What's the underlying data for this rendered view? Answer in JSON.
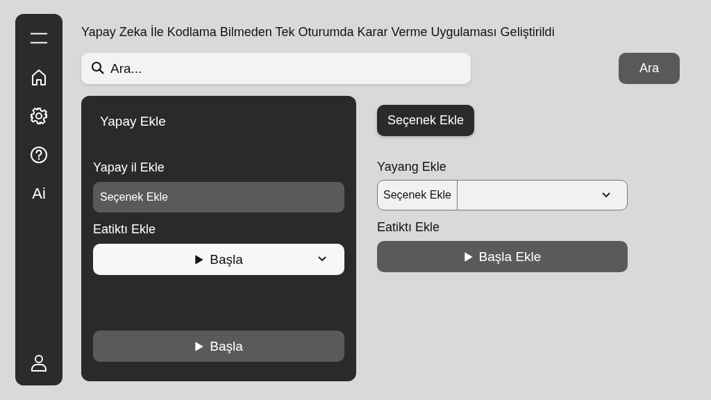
{
  "sidebar": {
    "items": [
      {
        "kind": "menu"
      },
      {
        "kind": "home"
      },
      {
        "kind": "settings"
      },
      {
        "kind": "help"
      },
      {
        "kind": "text",
        "label": "Ai"
      }
    ],
    "bottom": {
      "kind": "user"
    }
  },
  "title": "Yapay Zeka İle Kodlama Bilmeden Tek Oturumda Karar Verme Uygulaması Geliştirildi",
  "search": {
    "placeholder": "Ara...",
    "button": "Ara"
  },
  "left_panel": {
    "heading": "Yapay Ekle",
    "field_label": "Yapay il Ekle",
    "field_value": "Seçenek Ekle",
    "select_label": "Eatiktı Ekle",
    "select_value": "Başla",
    "button": "Başla"
  },
  "right_panel": {
    "button": "Seçenek Ekle",
    "field_label": "Yayang Ekle",
    "select_value": "Seçenek Ekle",
    "label": "Eatiktı Ekle",
    "start_button": "Başla Ekle"
  }
}
